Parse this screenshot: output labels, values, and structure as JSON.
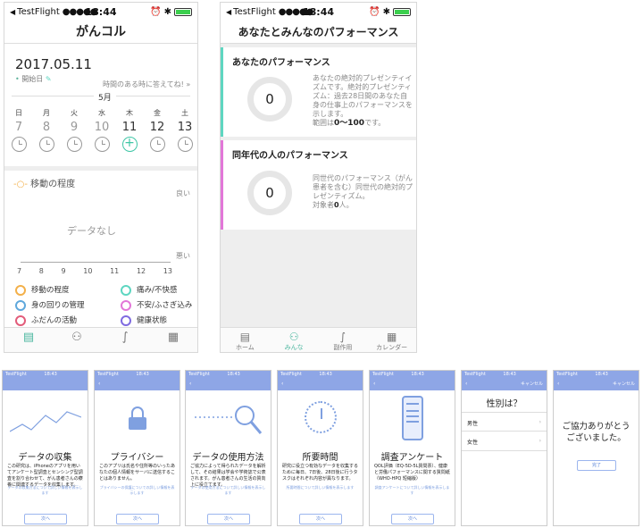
{
  "status": {
    "carrier": "TestFlight",
    "time": "18:44",
    "mini_carrier": "TestFlight",
    "mini_time": "18:43"
  },
  "home": {
    "title": "がんコル",
    "date": "2017.05.11",
    "start_label": "開始日",
    "prompt": "時間のある時に答えてね!",
    "prompt_arrow": "»",
    "month": "5月",
    "days": [
      {
        "d": "日",
        "n": "7"
      },
      {
        "d": "月",
        "n": "8"
      },
      {
        "d": "火",
        "n": "9"
      },
      {
        "d": "水",
        "n": "10"
      },
      {
        "d": "木",
        "n": "11"
      },
      {
        "d": "金",
        "n": "12"
      },
      {
        "d": "土",
        "n": "13"
      }
    ],
    "metric_label": "移動の程度",
    "good": "良い",
    "bad": "悪い",
    "no_data": "データなし",
    "x_ticks": [
      "7",
      "8",
      "9",
      "10",
      "11",
      "12",
      "13"
    ],
    "legend": [
      {
        "label": "移動の程度",
        "color": "#f3b04a"
      },
      {
        "label": "痛み/不快感",
        "color": "#5ed6c1"
      },
      {
        "label": "身の回りの管理",
        "color": "#5fa8dc"
      },
      {
        "label": "不安/ふさぎ込み",
        "color": "#e277d8"
      },
      {
        "label": "ふだんの活動",
        "color": "#e25c7a"
      },
      {
        "label": "健康状態",
        "color": "#7f6be0"
      }
    ],
    "icons": [
      "home-icon",
      "people-icon",
      "stethoscope-icon",
      "calendar-icon"
    ]
  },
  "perf": {
    "title": "あなたとみんなのパフォーマンス",
    "you_title": "あなたのパフォーマンス",
    "you_value": "0",
    "you_desc": "あなたの絶対的プレゼンティイズムです。絶対的プレゼンティズム：過去28日間のあなた自身の仕事上のパフォーマンスを示します。",
    "you_range_pre": "範囲は",
    "you_range": "0〜100",
    "you_range_post": "です。",
    "peer_title": "同年代の人のパフォーマンス",
    "peer_value": "0",
    "peer_desc": "同世代のパフォーマンス（がん患者を含む）同世代の絶対的プレゼンティズム。",
    "peer_count_pre": "対象者",
    "peer_count": "0",
    "peer_count_post": "人。",
    "tabs": [
      "ホーム",
      "みんな",
      "副作用",
      "カレンダー"
    ]
  },
  "onboard": [
    {
      "title": "データの収集",
      "desc": "この研究は、iPhoneのアプリを用いてアンケート型調査とセンシング型調査を割り合わせて、がん患者さんの療養に関連するデータを収集します。",
      "link": "データの収集方法について詳しい情報を表示します",
      "button": "次へ",
      "icon": "chart-line-icon"
    },
    {
      "title": "プライバシー",
      "desc": "このアプリは氏名や住所等のいったあなたの個人情報をサーバに送信することはありません。",
      "link": "プライバシーの保護についての詳しい情報を表示します",
      "button": "次へ",
      "icon": "lock-icon"
    },
    {
      "title": "データの使用方法",
      "desc": "ご協力によって得られたデータを解析して、その結果は学会や学術誌で公表されます。がん患者さんの生活の質向上に役立てます。",
      "link": "データの使用方法について詳しい情報を表示します",
      "button": "次へ",
      "icon": "magnifier-icon"
    },
    {
      "title": "所要時間",
      "desc": "研究に役立つ有効なデータを収集するために毎日、7日後、28日後に行うタスクはそれぞれ内容が異なります。",
      "link": "所要時間について詳しい情報を表示します",
      "button": "次へ",
      "icon": "timer-icon"
    },
    {
      "title": "調査アンケート",
      "desc": "QOL評価（EQ-5D-5L質問票）、健康と労働パフォーマンスに関する質問紙（WHO-HPQ 短縮版）",
      "link": "調査アンケートについて詳しい情報を表示します",
      "button": "次へ",
      "icon": "phone-icon"
    },
    {
      "title": "性別は？",
      "nav_right": "キャンセル",
      "options": [
        "男性",
        "女性"
      ]
    },
    {
      "title": "ご協力ありがとうございました。",
      "nav_right": "キャンセル",
      "button": "完了"
    }
  ]
}
